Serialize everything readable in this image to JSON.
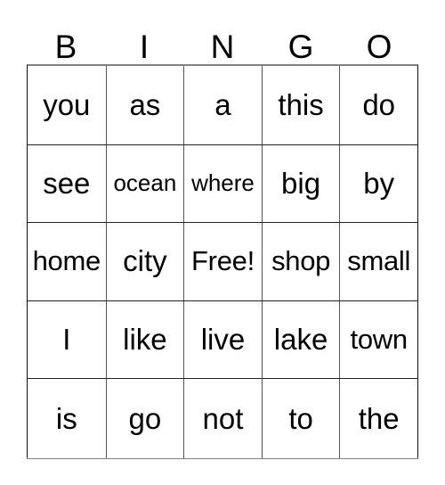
{
  "card": {
    "header_letters": [
      "B",
      "I",
      "N",
      "G",
      "O"
    ],
    "free_space_label": "Free!",
    "colors": {
      "text": "#000000",
      "background": "#ffffff",
      "grid_line": "#555555",
      "grid_outer_line": "#808080"
    },
    "columns": [
      {
        "letter": "B",
        "cells": [
          "you",
          "see",
          "home",
          "I",
          "is"
        ]
      },
      {
        "letter": "I",
        "cells": [
          "as",
          "ocean",
          "city",
          "like",
          "go"
        ]
      },
      {
        "letter": "N",
        "cells": [
          "a",
          "where",
          "Free!",
          "live",
          "not"
        ]
      },
      {
        "letter": "G",
        "cells": [
          "this",
          "big",
          "shop",
          "lake",
          "to"
        ]
      },
      {
        "letter": "O",
        "cells": [
          "do",
          "by",
          "small",
          "town",
          "the"
        ]
      }
    ],
    "rows": [
      [
        "you",
        "as",
        "a",
        "this",
        "do"
      ],
      [
        "see",
        "ocean",
        "where",
        "big",
        "by"
      ],
      [
        "home",
        "city",
        "Free!",
        "shop",
        "small"
      ],
      [
        "I",
        "like",
        "live",
        "lake",
        "town"
      ],
      [
        "is",
        "go",
        "not",
        "to",
        "the"
      ]
    ]
  }
}
